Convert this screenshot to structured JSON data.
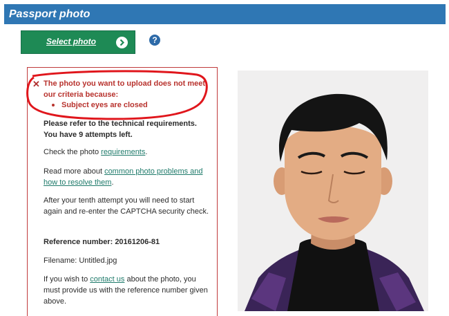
{
  "header": {
    "title": "Passport photo"
  },
  "select_button": {
    "label": "Select photo"
  },
  "help": {
    "label": "?"
  },
  "error": {
    "title": "The photo you want to upload does not meet our criteria because:",
    "items": [
      "Subject eyes are closed"
    ]
  },
  "info": {
    "attempts_line1": "Please refer to the technical requirements.",
    "attempts_line2": "You have 9 attempts left.",
    "check_prefix": "Check the photo ",
    "check_link": "requirements",
    "check_suffix": ".",
    "readmore_prefix": "Read more about ",
    "readmore_link": "common photo problems and how to resolve them",
    "readmore_suffix": ".",
    "tenth": "After your tenth attempt you will need to start again and re-enter the CAPTCHA security check.",
    "reference_label": "Reference number: ",
    "reference_value": "20161206-81",
    "filename_label": "Filename: ",
    "filename_value": "Untitled.jpg",
    "contact_prefix": "If you wish to ",
    "contact_link": "contact us",
    "contact_suffix": " about the photo, you must provide us with the reference number given above."
  },
  "colors": {
    "header_bg": "#2f77b4",
    "button_bg": "#1e8a55",
    "error_red": "#b8332e",
    "link": "#1e7a6a"
  },
  "icons": [
    "chevron-right-icon",
    "help-icon",
    "error-x-icon"
  ]
}
